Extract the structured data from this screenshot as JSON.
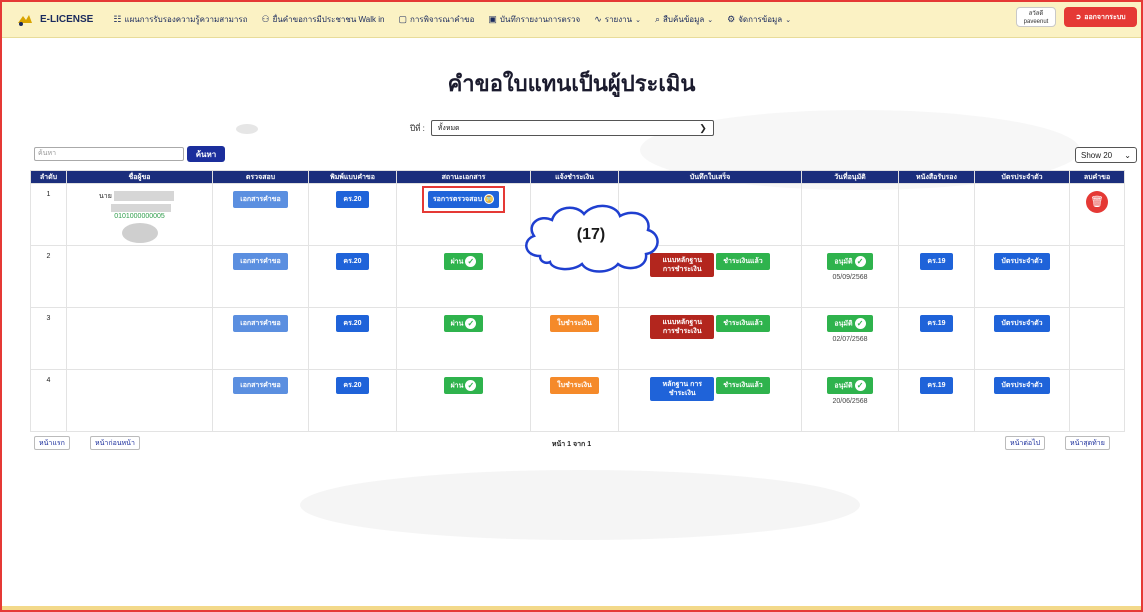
{
  "brand": {
    "name": "E-LICENSE"
  },
  "nav": [
    {
      "icon": "book-icon",
      "glyph": "☷",
      "label": "แผนการรับรองความรู้ความสามารถ"
    },
    {
      "icon": "user-icon",
      "glyph": "⚇",
      "label": "ยื่นคำขอการมีประชาชน Walk in"
    },
    {
      "icon": "document-icon",
      "glyph": "▢",
      "label": "การพิจารณาคำขอ"
    },
    {
      "icon": "clipboard-icon",
      "glyph": "▣",
      "label": "บันทึกรายงานการตรวจ"
    },
    {
      "icon": "chart-icon",
      "glyph": "∿",
      "label": "รายงาน",
      "dropdown": true
    },
    {
      "icon": "search-icon",
      "glyph": "⌕",
      "label": "สืบค้นข้อมูล",
      "dropdown": true
    },
    {
      "icon": "gear-icon",
      "glyph": "⚙",
      "label": "จัดการข้อมูล",
      "dropdown": true
    }
  ],
  "user": {
    "greeting": "สวัสดี",
    "username": "paveenut"
  },
  "logout_label": "ออกจากระบบ",
  "page_title": "คำขอใบแทนเป็นผู้ประเมิน",
  "filter": {
    "year_label": "ปีที่ :",
    "year_value": "ทั้งหมด"
  },
  "search": {
    "placeholder": "ค้นหา",
    "button": "ค้นหา"
  },
  "show": {
    "value": "Show 20"
  },
  "table": {
    "headers": [
      "ลำดับ",
      "ชื่อผู้ขอ",
      "ตรวจสอบ",
      "พิมพ์แบบคำขอ",
      "สถานะเอกสาร",
      "แจ้งชำระเงิน",
      "บันทึกใบเสร็จ",
      "วันที่อนุมัติ",
      "หนังสือรับรอง",
      "บัตรประจำตัว",
      "ลบคำขอ"
    ],
    "rows": [
      {
        "no": "1",
        "name_prefix": "นาย",
        "id": "0101000000005",
        "check": "เอกสารคำขอ",
        "print": "คร.20",
        "status": "รอการตรวจสอบ"
      },
      {
        "no": "2",
        "check": "เอกสารคำขอ",
        "print": "คร.20",
        "status": "ผ่าน",
        "receipt1": "แนบหลักฐาน การชำระเงิน",
        "receipt2": "ชำระเงินแล้ว",
        "approve": "อนุมัติ",
        "approve_date": "05/09/2568",
        "cert": "คร.19",
        "card": "บัตรประจำตัว"
      },
      {
        "no": "3",
        "check": "เอกสารคำขอ",
        "print": "คร.20",
        "status": "ผ่าน",
        "payment": "ใบชำระเงิน",
        "receipt1": "แนบหลักฐาน การชำระเงิน",
        "receipt2": "ชำระเงินแล้ว",
        "approve": "อนุมัติ",
        "approve_date": "02/07/2568",
        "cert": "คร.19",
        "card": "บัตรประจำตัว"
      },
      {
        "no": "4",
        "check": "เอกสารคำขอ",
        "print": "คร.20",
        "status": "ผ่าน",
        "payment": "ใบชำระเงิน",
        "receipt1": "หลักฐาน การชำระเงิน",
        "receipt2": "ชำระเงินแล้ว",
        "approve": "อนุมัติ",
        "approve_date": "20/06/2568",
        "cert": "คร.19",
        "card": "บัตรประจำตัว"
      }
    ]
  },
  "pager": {
    "first": "หน้าแรก",
    "prev": "หน้าก่อนหน้า",
    "info": "หน้า 1 จาก 1",
    "next": "หน้าต่อไป",
    "last": "หน้าสุดท้าย"
  },
  "callout": {
    "label": "(17)"
  },
  "colors": {
    "navbar": "#fbf2c4",
    "header": "#1b2e7c",
    "accent_red": "#e53935",
    "green": "#2fb34d",
    "orange": "#f58a2a"
  }
}
